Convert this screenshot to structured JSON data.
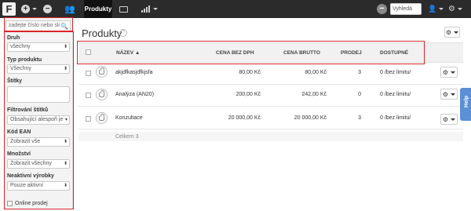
{
  "topbar": {
    "logo": "F",
    "active_tab": "Produkty",
    "search_label": "Vyhledá"
  },
  "sidebar": {
    "search_placeholder": "zadejte číslo nebo slo",
    "filters": [
      {
        "label": "Druh",
        "value": "všechny"
      },
      {
        "label": "Typ produktu",
        "value": "Všechny"
      },
      {
        "label": "Štítky",
        "value": ""
      },
      {
        "label": "Filtrování štítků",
        "value": "Obsahující alespoň je"
      },
      {
        "label": "Kód EAN",
        "value": "Zobrazit vše"
      },
      {
        "label": "Množství",
        "value": "Zobrazit všechny"
      },
      {
        "label": "Neaktivní výrobky",
        "value": "Pouze aktivní"
      }
    ],
    "online_label": "Online prodej"
  },
  "main": {
    "title": "Produkty",
    "help_mark": "?",
    "columns": [
      "NÁZEV ▲",
      "CENA BEZ DPH",
      "CENA BRUTTO",
      "PRODEJ",
      "DOSTUPNÉ"
    ],
    "rows": [
      {
        "name": "akjdfkasjdfkjsfa",
        "price_net": "80,00 Kč",
        "price_gross": "80,00 Kč",
        "sales": "3",
        "available": "0 /bez limitu/"
      },
      {
        "name": "Analýza (AN20)",
        "price_net": "200,00 Kč",
        "price_gross": "242,00 Kč",
        "sales": "0",
        "available": "0 /bez limitu/"
      },
      {
        "name": "Konzultace",
        "price_net": "20 000,00 Kč",
        "price_gross": "20 000,00 Kč",
        "sales": "3",
        "available": "0 /bez limitu/"
      }
    ],
    "total": "Celkem 3"
  },
  "help_tab": "Help",
  "colors": {
    "topbar": "#2b2b2b",
    "highlight": "#d9252b",
    "help_tab": "#5b8fd6"
  }
}
